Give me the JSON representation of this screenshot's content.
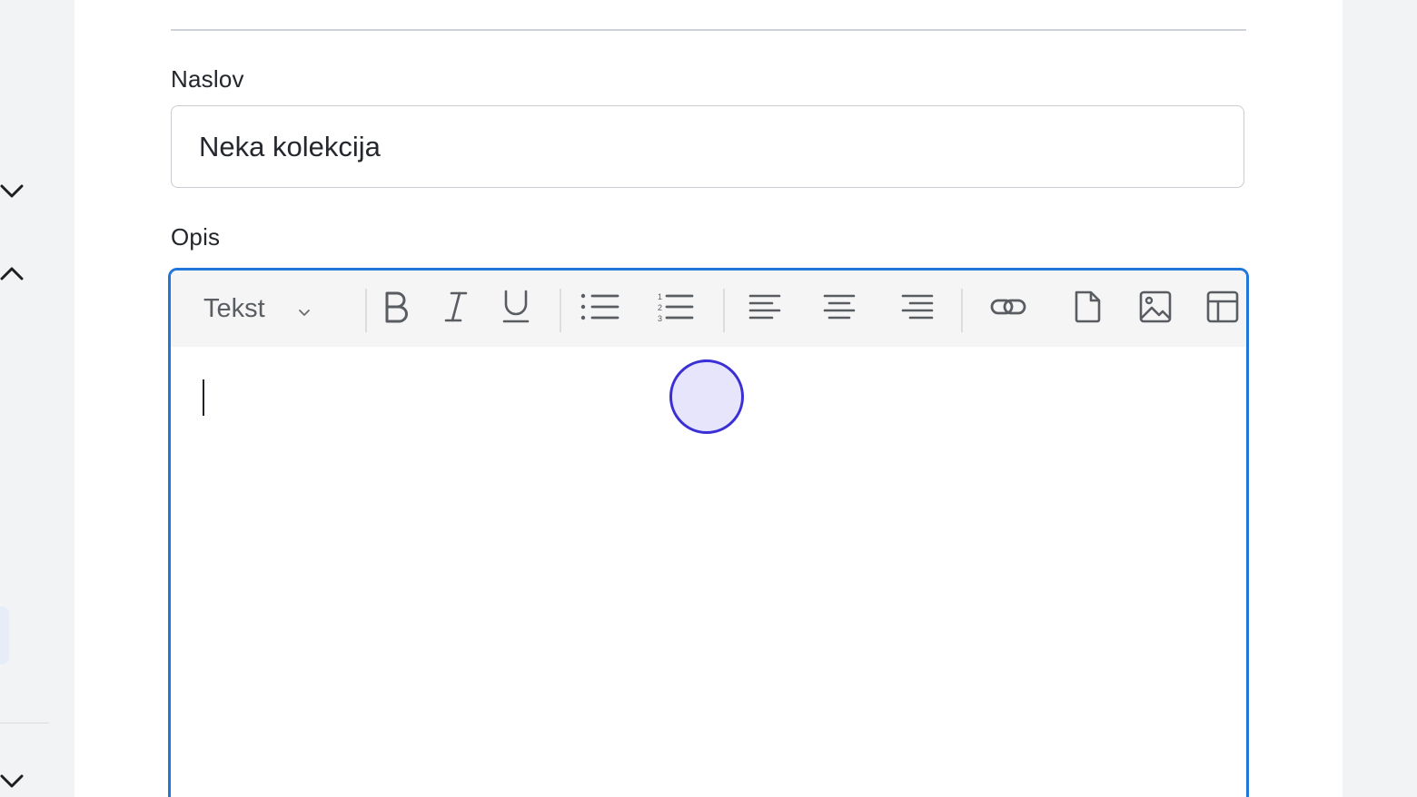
{
  "form": {
    "title_label": "Naslov",
    "title_value": "Neka kolekcija",
    "description_label": "Opis"
  },
  "editor": {
    "block_type": "Tekst",
    "toolbar": [
      {
        "name": "bold-button",
        "icon": "bold-icon"
      },
      {
        "name": "italic-button",
        "icon": "italic-icon"
      },
      {
        "name": "underline-button",
        "icon": "underline-icon"
      },
      {
        "name": "bullet-list-button",
        "icon": "bullet-list-icon"
      },
      {
        "name": "numbered-list-button",
        "icon": "numbered-list-icon"
      },
      {
        "name": "align-left-button",
        "icon": "align-left-icon"
      },
      {
        "name": "align-center-button",
        "icon": "align-center-icon"
      },
      {
        "name": "align-right-button",
        "icon": "align-right-icon"
      },
      {
        "name": "link-button",
        "icon": "link-icon"
      },
      {
        "name": "file-button",
        "icon": "file-icon"
      },
      {
        "name": "image-button",
        "icon": "image-icon"
      },
      {
        "name": "layout-button",
        "icon": "layout-icon"
      }
    ],
    "content": ""
  },
  "colors": {
    "accent": "#2176d9",
    "click_marker": "#3b2fd6",
    "background": "#f2f3f5"
  }
}
